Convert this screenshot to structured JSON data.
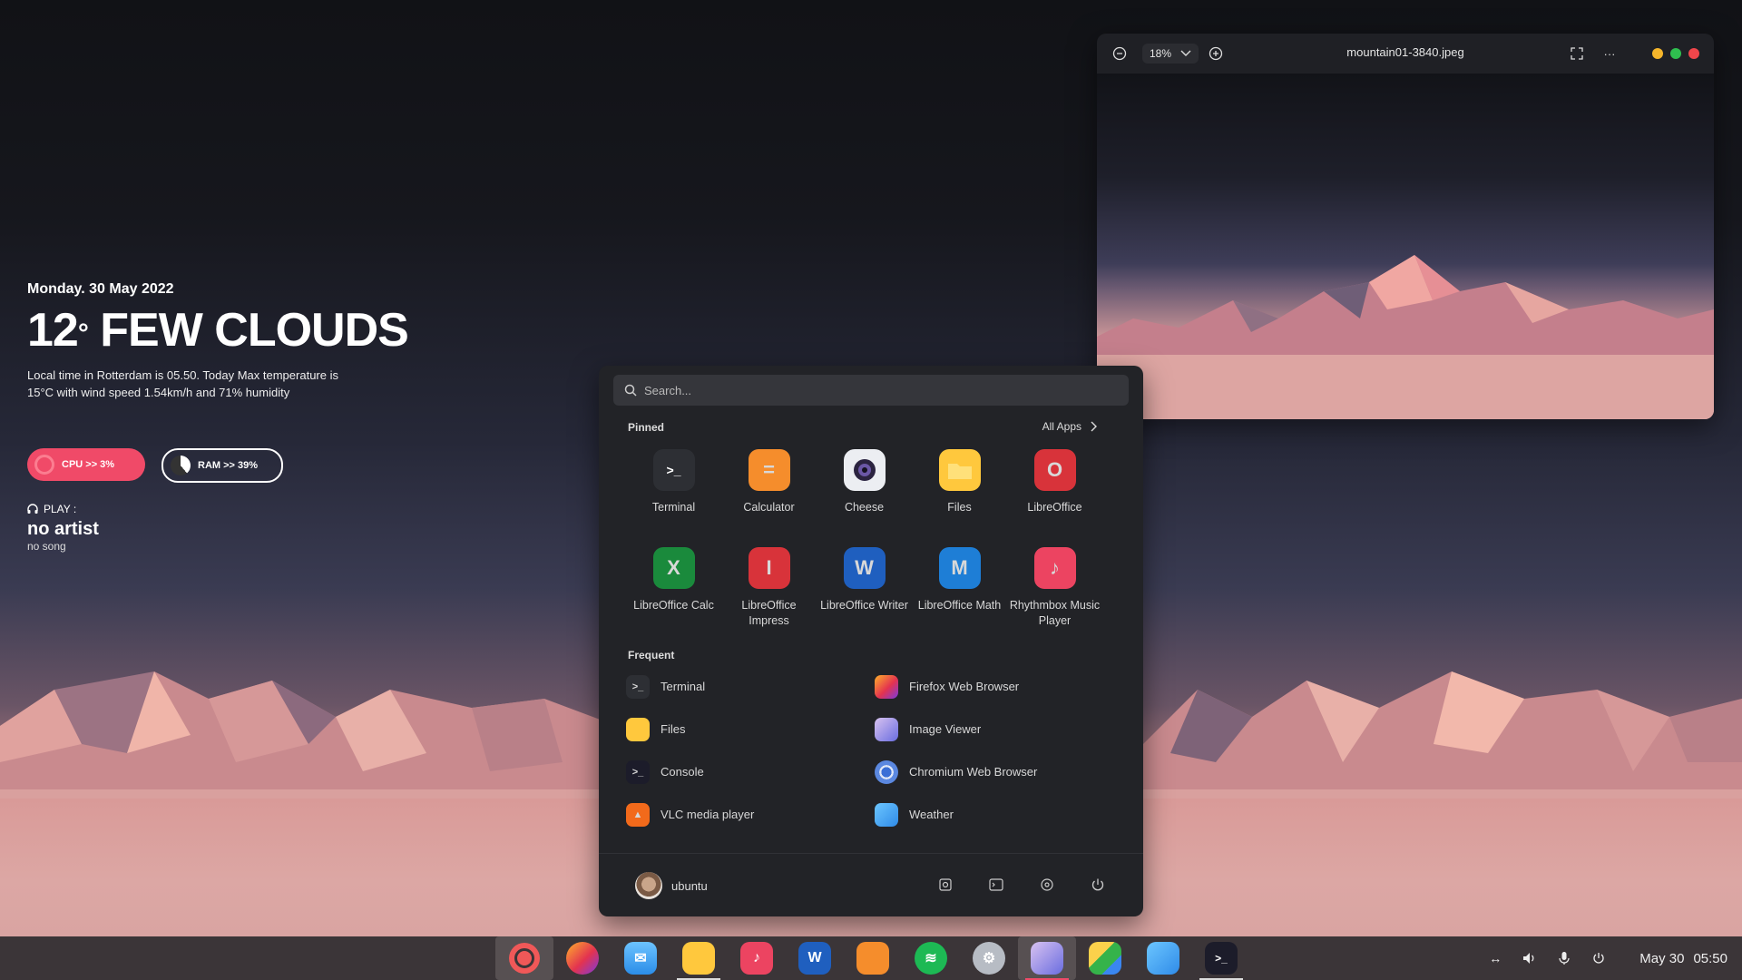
{
  "widget": {
    "date": "Monday. 30 May 2022",
    "temperature": "12",
    "degree": "°",
    "condition": "FEW CLOUDS",
    "description_line1": "Local time in Rotterdam  is 05.50. Today Max temperature is",
    "description_line2": "15°C with wind speed 1.54km/h and 71% humidity",
    "cpu_label": "CPU >> 3%",
    "ram_label": "RAM >> 39%",
    "play_label": "PLAY :",
    "artist": "no artist",
    "song": "no song"
  },
  "viewer": {
    "zoom": "18%",
    "title": "mountain01-3840.jpeg",
    "traffic_colors": [
      "#f5b52b",
      "#2fbf4f",
      "#f0464b"
    ]
  },
  "menu": {
    "search_placeholder": "Search...",
    "pinned_title": "Pinned",
    "all_apps": "All Apps",
    "pinned": [
      {
        "label": "Terminal",
        "icon": "terminal-icon"
      },
      {
        "label": "Calculator",
        "icon": "calculator-icon"
      },
      {
        "label": "Cheese",
        "icon": "camera-icon"
      },
      {
        "label": "Files",
        "icon": "folder-icon"
      },
      {
        "label": "LibreOffice",
        "icon": "libreoffice-icon"
      },
      {
        "label": "LibreOffice Calc",
        "icon": "spreadsheet-icon"
      },
      {
        "label": "LibreOffice Impress",
        "icon": "presentation-icon"
      },
      {
        "label": "LibreOffice Writer",
        "icon": "document-icon"
      },
      {
        "label": "LibreOffice Math",
        "icon": "math-icon"
      },
      {
        "label": "Rhythmbox Music Player",
        "icon": "music-icon"
      }
    ],
    "frequent_title": "Frequent",
    "frequent": [
      {
        "label": "Terminal",
        "icon": "terminal-icon"
      },
      {
        "label": "Firefox Web Browser",
        "icon": "firefox-icon"
      },
      {
        "label": "Files",
        "icon": "folder-icon"
      },
      {
        "label": "Image Viewer",
        "icon": "image-viewer-icon"
      },
      {
        "label": "Console",
        "icon": "console-icon"
      },
      {
        "label": "Chromium Web Browser",
        "icon": "chromium-icon"
      },
      {
        "label": "VLC media player",
        "icon": "vlc-icon"
      },
      {
        "label": "Weather",
        "icon": "weather-icon"
      }
    ],
    "user": "ubuntu"
  },
  "taskbar": {
    "date": "May 30",
    "time": "05:50",
    "apps": [
      "app-menu",
      "firefox",
      "mail",
      "files",
      "music",
      "writer",
      "software",
      "spotify",
      "settings",
      "image-viewer",
      "maps",
      "weather",
      "terminal"
    ]
  }
}
